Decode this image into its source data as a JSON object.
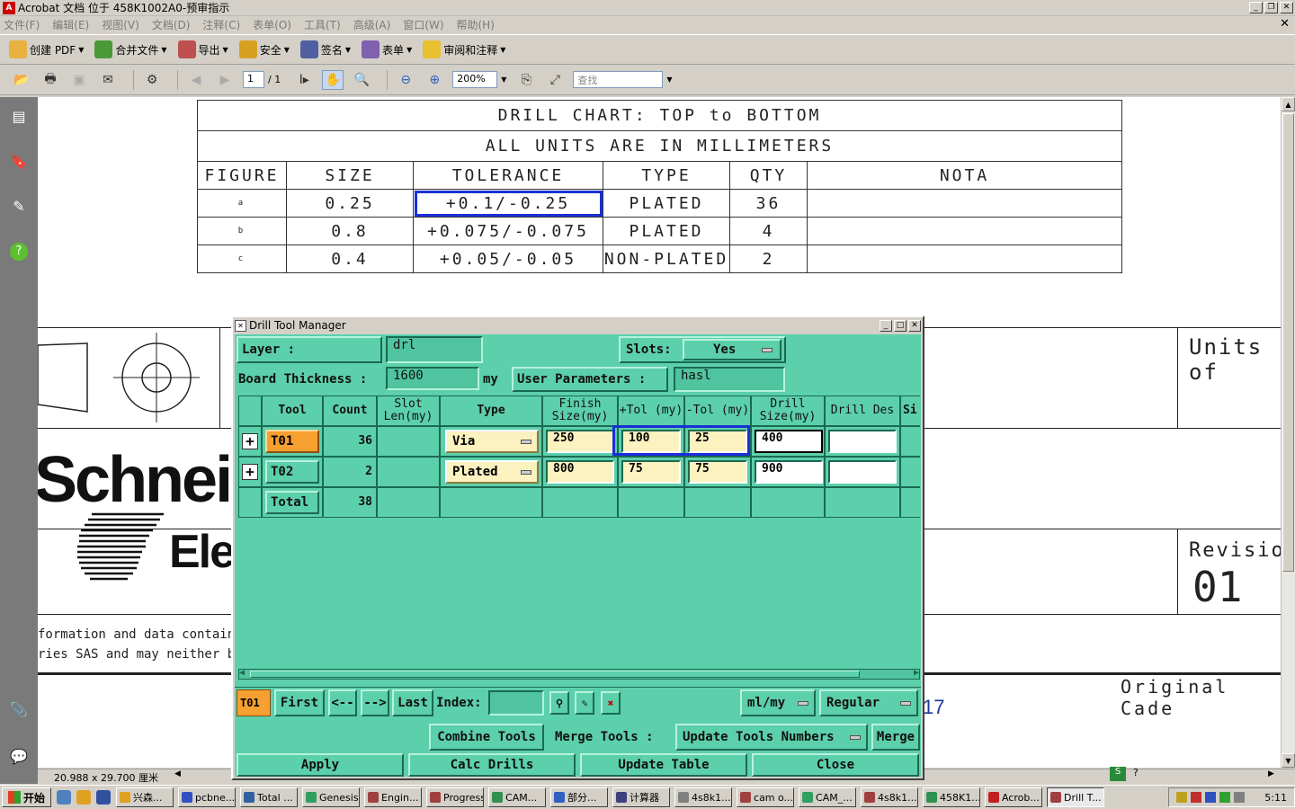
{
  "window": {
    "title": "Acrobat 文档 位于 458K1002A0-预审指示"
  },
  "menu": [
    "文件(F)",
    "编辑(E)",
    "视图(V)",
    "文档(D)",
    "注释(C)",
    "表单(O)",
    "工具(T)",
    "高级(A)",
    "窗口(W)",
    "帮助(H)"
  ],
  "toolbar1": [
    "创建 PDF",
    "合并文件",
    "导出",
    "安全",
    "签名",
    "表单",
    "审阅和注释"
  ],
  "toolbar2": {
    "page_current": "1",
    "page_total": "/ 1",
    "zoom": "200%",
    "search_placeholder": "查找"
  },
  "drill_chart": {
    "title": "DRILL CHART: TOP to BOTTOM",
    "subtitle": "ALL UNITS ARE IN MILLIMETERS",
    "headers": [
      "FIGURE",
      "SIZE",
      "TOLERANCE",
      "TYPE",
      "QTY",
      "NOTA"
    ],
    "rows": [
      {
        "figure": "a",
        "size": "0.25",
        "tolerance": "+0.1/-0.25",
        "type": "PLATED",
        "qty": "36",
        "nota": ""
      },
      {
        "figure": "b",
        "size": "0.8",
        "tolerance": "+0.075/-0.075",
        "type": "PLATED",
        "qty": "4",
        "nota": ""
      },
      {
        "figure": "c",
        "size": "0.4",
        "tolerance": "+0.05/-0.05",
        "type": "NON-PLATED",
        "qty": "2",
        "nota": ""
      }
    ]
  },
  "drawing": {
    "units_label": "Units of",
    "revision_label": "Revision",
    "revision_value": "01",
    "brand_top": "Schnei",
    "brand_bottom": "Ele",
    "legal_line1": "formation and data contained in",
    "legal_line2": "ries SAS and may neither be use",
    "original_cade": "Original Cade",
    "page_fragment": "17"
  },
  "status": {
    "page_size": "20.988 x 29.700 厘米"
  },
  "dialog": {
    "title": "Drill Tool Manager",
    "layer_label": "Layer :",
    "layer_value": "drl",
    "slots_label": "Slots:",
    "slots_value": "Yes",
    "board_thickness_label": "Board Thickness :",
    "board_thickness_value": "1600",
    "board_thickness_unit": "my",
    "user_params_label": "User Parameters :",
    "user_params_value": "hasl",
    "columns": [
      "Tool",
      "Count",
      "Slot Len(my)",
      "Type",
      "Finish Size(my)",
      "+Tol (my)",
      "-Tol (my)",
      "Drill Size(my)",
      "Drill Des",
      "Si"
    ],
    "rows": [
      {
        "tool": "T01",
        "count": "36",
        "type": "Via",
        "finish": "250",
        "ptol": "100",
        "mtol": "25",
        "drill": "400"
      },
      {
        "tool": "T02",
        "count": "2",
        "type": "Plated",
        "finish": "800",
        "ptol": "75",
        "mtol": "75",
        "drill": "900"
      }
    ],
    "total_label": "Total",
    "total_count": "38",
    "nav": {
      "current": "T01",
      "first": "First",
      "prev": "<--",
      "next": "-->",
      "last": "Last",
      "index_label": "Index:",
      "units": "ml/my",
      "mode": "Regular"
    },
    "actions": {
      "combine": "Combine Tools",
      "merge_label": "Merge Tools :",
      "update_numbers": "Update Tools Numbers",
      "merge": "Merge"
    },
    "buttons": {
      "apply": "Apply",
      "calc": "Calc Drills",
      "update_table": "Update Table",
      "close": "Close"
    }
  },
  "taskbar": {
    "start": "开始",
    "items": [
      "兴森...",
      "pcbne...",
      "Total ...",
      "Genesis",
      "Engin...",
      "Progress",
      "CAM...",
      "部分...",
      "计算器",
      "4s8k1...",
      "cam o...",
      "CAM_...",
      "4s8k1...",
      "458K1...",
      "Acrob...",
      "Drill T..."
    ],
    "clock": "5:11"
  }
}
